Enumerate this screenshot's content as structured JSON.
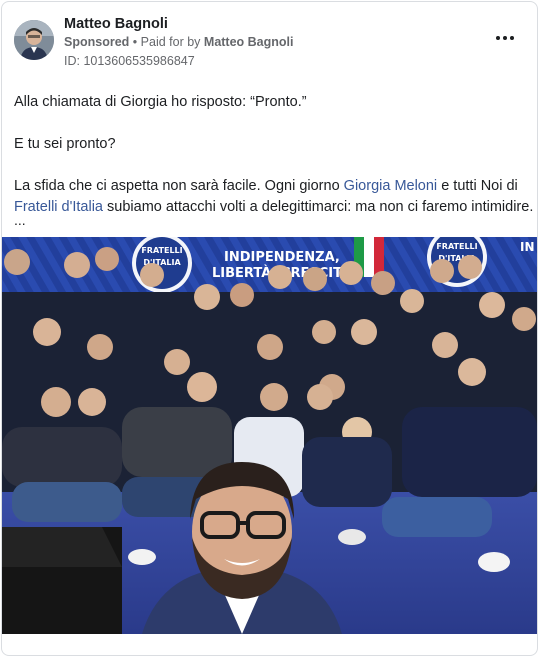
{
  "post": {
    "author": "Matteo Bagnoli",
    "sponsored_label": "Sponsored",
    "separator": "•",
    "paid_for_prefix": "Paid for by",
    "paid_for_name": "Matteo Bagnoli",
    "ad_id": "ID: 1013606535986847",
    "more_icon": "more-horizontal-icon"
  },
  "message": {
    "line1": "Alla chiamata di Giorgia ho risposto: “Pronto.”",
    "line2": "E tu sei pronto?",
    "line3_a": "La sfida che ci aspetta non sarà facile. Ogni giorno ",
    "line3_link": "Giorgia Meloni",
    "line3_b": " e tutti Noi di",
    "line4_link": "Fratelli d'Italia",
    "line4_b": " subiamo attacchi volti a delegittimarci: ma non ci faremo intimidire.",
    "ellipsis": "..."
  },
  "photo": {
    "banner_logo_left_1": "FRATELLI",
    "banner_logo_left_2": "D'ITALIA",
    "banner_line1": "INDIPENDENZA,",
    "banner_line2": "LIBERTÀ, CRESCITA",
    "banner_logo_right_1": "FRATELLI",
    "banner_logo_right_2": "D'ITALIA",
    "banner_right_fragment": "IN"
  },
  "colors": {
    "link": "#385898",
    "secondary_text": "#65676b",
    "banner_blue": "#1f3c8f"
  }
}
